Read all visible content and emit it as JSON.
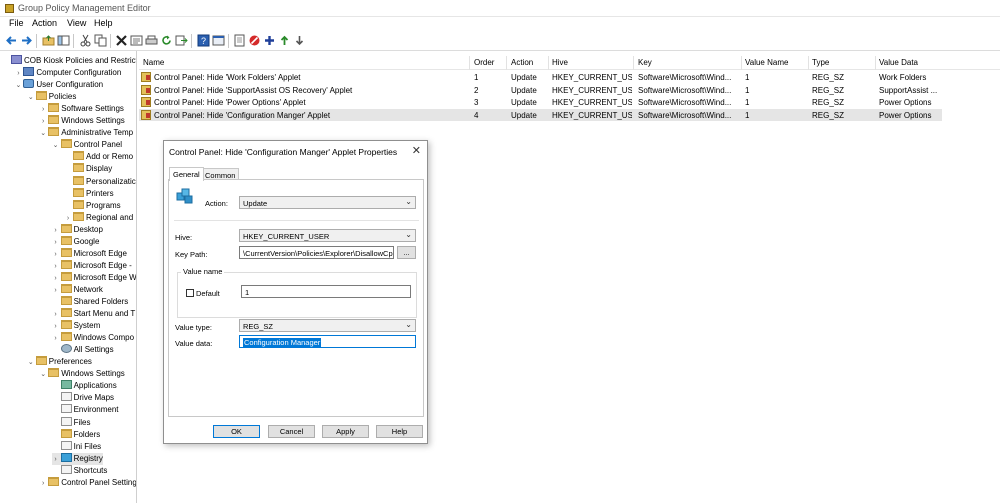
{
  "window": {
    "title": "Group Policy Management Editor"
  },
  "menu": [
    "File",
    "Action",
    "View",
    "Help"
  ],
  "toolbar": {
    "icons": [
      "back-icon",
      "forward-icon",
      "up-folder-icon",
      "show-hide-tree-icon",
      "cut-icon",
      "copy-icon",
      "delete-icon",
      "properties-icon",
      "print-icon",
      "refresh-icon",
      "export-icon",
      "help-icon",
      "console-icon",
      "new-doc-icon",
      "stop-icon",
      "add-icon",
      "move-up-icon",
      "move-down-icon"
    ]
  },
  "tree": [
    {
      "label": "COB Kiosk Policies and Restrictio",
      "level": 0,
      "expander": "",
      "icon": "gp"
    },
    {
      "label": "Computer Configuration",
      "level": 1,
      "expander": "›",
      "icon": "cfg"
    },
    {
      "label": "User Configuration",
      "level": 1,
      "expander": "⌄",
      "icon": "usr"
    },
    {
      "label": "Policies",
      "level": 2,
      "expander": "⌄",
      "icon": "folder"
    },
    {
      "label": "Software Settings",
      "level": 3,
      "expander": "›",
      "icon": "folder"
    },
    {
      "label": "Windows Settings",
      "level": 3,
      "expander": "›",
      "icon": "folder"
    },
    {
      "label": "Administrative Temp",
      "level": 3,
      "expander": "⌄",
      "icon": "folder"
    },
    {
      "label": "Control Panel",
      "level": 4,
      "expander": "⌄",
      "icon": "folder"
    },
    {
      "label": "Add or Remo",
      "level": 5,
      "expander": "",
      "icon": "folder"
    },
    {
      "label": "Display",
      "level": 5,
      "expander": "",
      "icon": "folder"
    },
    {
      "label": "Personalizatic",
      "level": 5,
      "expander": "",
      "icon": "folder"
    },
    {
      "label": "Printers",
      "level": 5,
      "expander": "",
      "icon": "folder"
    },
    {
      "label": "Programs",
      "level": 5,
      "expander": "",
      "icon": "folder"
    },
    {
      "label": "Regional and",
      "level": 5,
      "expander": "›",
      "icon": "folder"
    },
    {
      "label": "Desktop",
      "level": 4,
      "expander": "›",
      "icon": "folder"
    },
    {
      "label": "Google",
      "level": 4,
      "expander": "›",
      "icon": "folder"
    },
    {
      "label": "Microsoft Edge",
      "level": 4,
      "expander": "›",
      "icon": "folder"
    },
    {
      "label": "Microsoft Edge -",
      "level": 4,
      "expander": "›",
      "icon": "folder"
    },
    {
      "label": "Microsoft Edge W",
      "level": 4,
      "expander": "›",
      "icon": "folder"
    },
    {
      "label": "Network",
      "level": 4,
      "expander": "›",
      "icon": "folder"
    },
    {
      "label": "Shared Folders",
      "level": 4,
      "expander": "",
      "icon": "folder"
    },
    {
      "label": "Start Menu and T",
      "level": 4,
      "expander": "›",
      "icon": "folder"
    },
    {
      "label": "System",
      "level": 4,
      "expander": "›",
      "icon": "folder"
    },
    {
      "label": "Windows Compo",
      "level": 4,
      "expander": "›",
      "icon": "folder"
    },
    {
      "label": "All Settings",
      "level": 4,
      "expander": "",
      "icon": "gear"
    },
    {
      "label": "Preferences",
      "level": 2,
      "expander": "⌄",
      "icon": "folder"
    },
    {
      "label": "Windows Settings",
      "level": 3,
      "expander": "⌄",
      "icon": "folder"
    },
    {
      "label": "Applications",
      "level": 4,
      "expander": "",
      "icon": "set"
    },
    {
      "label": "Drive Maps",
      "level": 4,
      "expander": "",
      "icon": "file"
    },
    {
      "label": "Environment",
      "level": 4,
      "expander": "",
      "icon": "file"
    },
    {
      "label": "Files",
      "level": 4,
      "expander": "",
      "icon": "file"
    },
    {
      "label": "Folders",
      "level": 4,
      "expander": "",
      "icon": "folder"
    },
    {
      "label": "Ini Files",
      "level": 4,
      "expander": "",
      "icon": "file"
    },
    {
      "label": "Registry",
      "level": 4,
      "expander": "›",
      "icon": "reg",
      "selected": true
    },
    {
      "label": "Shortcuts",
      "level": 4,
      "expander": "",
      "icon": "file"
    },
    {
      "label": "Control Panel Setting",
      "level": 3,
      "expander": "›",
      "icon": "folder"
    }
  ],
  "list": {
    "columns": [
      "Name",
      "Order",
      "Action",
      "Hive",
      "Key",
      "Value Name",
      "Type",
      "Value Data"
    ],
    "rows": [
      {
        "name": "Control Panel: Hide 'Work Folders' Applet",
        "order": "1",
        "action": "Update",
        "hive": "HKEY_CURRENT_USER",
        "key": "Software\\Microsoft\\Wind...",
        "value_name": "1",
        "type": "REG_SZ",
        "value_data": "Work Folders"
      },
      {
        "name": "Control Panel: Hide 'SupportAssist OS Recovery' Applet",
        "order": "2",
        "action": "Update",
        "hive": "HKEY_CURRENT_USER",
        "key": "Software\\Microsoft\\Wind...",
        "value_name": "1",
        "type": "REG_SZ",
        "value_data": "SupportAssist ..."
      },
      {
        "name": "Control Panel: Hide 'Power Options' Applet",
        "order": "3",
        "action": "Update",
        "hive": "HKEY_CURRENT_USER",
        "key": "Software\\Microsoft\\Wind...",
        "value_name": "1",
        "type": "REG_SZ",
        "value_data": "Power Options"
      },
      {
        "name": "Control Panel: Hide 'Configuration Manger' Applet",
        "order": "4",
        "action": "Update",
        "hive": "HKEY_CURRENT_USER",
        "key": "Software\\Microsoft\\Wind...",
        "value_name": "1",
        "type": "REG_SZ",
        "value_data": "Power Options",
        "selected": true
      }
    ]
  },
  "dialog": {
    "title": "Control Panel: Hide 'Configuration Manger' Applet Properties",
    "close": "✕",
    "tabs": [
      "General",
      "Common"
    ],
    "action_label": "Action:",
    "action_value": "Update",
    "hive_label": "Hive:",
    "hive_value": "HKEY_CURRENT_USER",
    "keypath_label": "Key Path:",
    "keypath_value": "\\CurrentVersion\\Policies\\Explorer\\DisallowCpl",
    "browse": "...",
    "value_name_group": "Value name",
    "default_label": "Default",
    "value_name_value": "1",
    "value_type_label": "Value type:",
    "value_type_value": "REG_SZ",
    "value_data_label": "Value data:",
    "value_data_value": "Configuration Manager",
    "buttons": {
      "ok": "OK",
      "cancel": "Cancel",
      "apply": "Apply",
      "help": "Help"
    }
  }
}
